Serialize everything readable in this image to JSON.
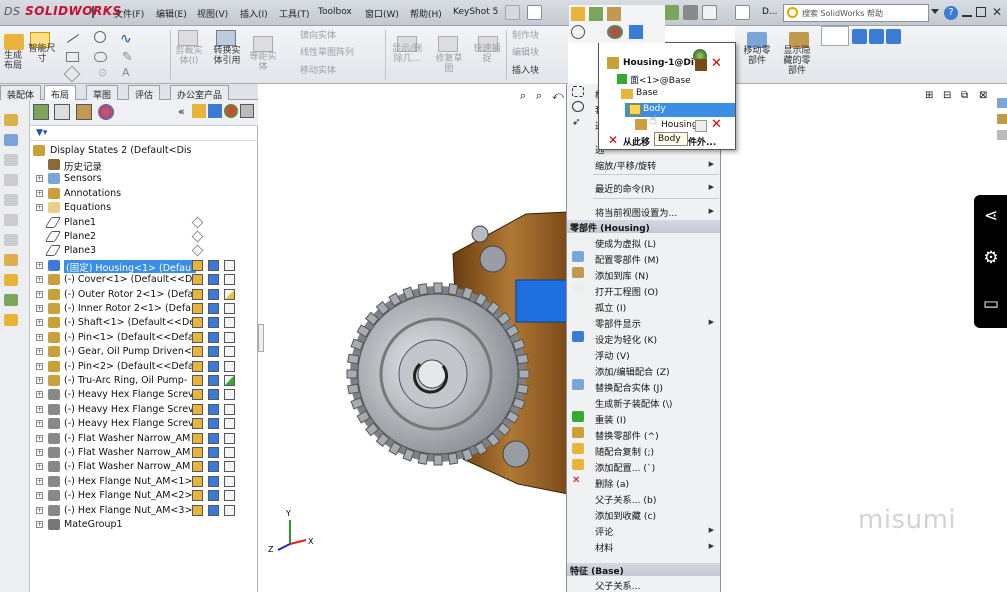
{
  "app": {
    "brand": "SOLIDWORKS",
    "brand_prefix": "DS",
    "title_short": "D..."
  },
  "menubar": [
    {
      "label": "文件(F)"
    },
    {
      "label": "编辑(E)"
    },
    {
      "label": "视图(V)"
    },
    {
      "label": "插入(I)"
    },
    {
      "label": "工具(T)"
    },
    {
      "label": "Toolbox"
    },
    {
      "label": "窗口(W)"
    },
    {
      "label": "帮助(H)"
    },
    {
      "label": "KeyShot 5"
    }
  ],
  "search": {
    "placeholder": "搜索 SolidWorks 帮助"
  },
  "ribbon": {
    "generate_layout": "生成\n布局",
    "smart_dim": "智能尺\n寸",
    "cut_solid": "剪裁实\n体(I)",
    "convert_solid": "转换实\n体引用",
    "offset_solid": "等距实\n体",
    "mirror_solid": "镜向实体",
    "linear_pattern": "线性草图阵列",
    "move_solid": "移动实体",
    "show_hide": "显示/删\n除几...",
    "repair_sketch": "修复草\n图",
    "quick_snap": "快速捕\n捉",
    "make_block": "制作块",
    "edit_block": "编辑块",
    "insert_block": "插入块",
    "move_part": "移动零\n部件",
    "show_hidden": "显示隐\n藏的零\n部件"
  },
  "tabs": [
    {
      "label": "装配体"
    },
    {
      "label": "布局"
    },
    {
      "label": "草图"
    },
    {
      "label": "评估"
    },
    {
      "label": "办公室产品"
    }
  ],
  "tree": {
    "root": "Display States 2  (Default<Dis",
    "nodes": [
      {
        "label": "历史记录",
        "icon": "history-icon"
      },
      {
        "label": "Sensors",
        "icon": "sensor-icon"
      },
      {
        "label": "Annotations",
        "icon": "annotation-icon"
      },
      {
        "label": "Equations",
        "icon": "equation-icon"
      },
      {
        "label": "Plane1",
        "icon": "plane-icon"
      },
      {
        "label": "Plane2",
        "icon": "plane-icon"
      },
      {
        "label": "Plane3",
        "icon": "plane-icon"
      },
      {
        "label": "(固定) Housing<1> (Defaul",
        "icon": "part-icon",
        "selected": true
      },
      {
        "label": "(-) Cover<1> (Default<<De",
        "icon": "part-icon"
      },
      {
        "label": "(-) Outer Rotor 2<1> (Defa",
        "icon": "part-icon"
      },
      {
        "label": "(-) Inner Rotor 2<1> (Defa",
        "icon": "part-icon"
      },
      {
        "label": "(-) Shaft<1> (Default<<De",
        "icon": "part-icon"
      },
      {
        "label": "(-) Pin<1> (Default<<Defa",
        "icon": "part-icon"
      },
      {
        "label": "(-) Gear, Oil Pump Driven<",
        "icon": "part-icon"
      },
      {
        "label": "(-) Pin<2> (Default<<Defa",
        "icon": "part-icon"
      },
      {
        "label": "(-) Tru-Arc Ring, Oil Pump-",
        "icon": "part-icon"
      },
      {
        "label": "(-) Heavy Hex Flange Screv",
        "icon": "toolbox-icon"
      },
      {
        "label": "(-) Heavy Hex Flange Screv",
        "icon": "toolbox-icon"
      },
      {
        "label": "(-) Heavy Hex Flange Screv",
        "icon": "toolbox-icon"
      },
      {
        "label": "(-) Flat Washer Narrow_AM",
        "icon": "toolbox-icon"
      },
      {
        "label": "(-) Flat Washer Narrow_AM",
        "icon": "toolbox-icon"
      },
      {
        "label": "(-) Flat Washer Narrow_AM",
        "icon": "toolbox-icon"
      },
      {
        "label": "(-) Hex Flange Nut_AM<1>",
        "icon": "toolbox-icon"
      },
      {
        "label": "(-) Hex Flange Nut_AM<2>",
        "icon": "toolbox-icon"
      },
      {
        "label": "(-) Hex Flange Nut_AM<3>",
        "icon": "toolbox-icon"
      },
      {
        "label": "MateGroup1",
        "icon": "mate-icon"
      }
    ]
  },
  "popup": {
    "housing": "Housing-1@Di...",
    "face": "面<1>@Base",
    "base": "Base",
    "body": "Body",
    "housing2": "Housing",
    "remove": "从此移",
    "parts_outside": "部件外...",
    "tooltip": "Body"
  },
  "context_menu": {
    "top_items": [
      {
        "label": "框"
      },
      {
        "label": "套"
      },
      {
        "label": "选"
      }
    ],
    "select_other": "选",
    "zoom_pan_rotate": "缩放/平移/旋转",
    "recent_commands": "最近的命令(R)",
    "set_view": "将当前视图设置为...",
    "section_part": "零部件 (Housing)",
    "items": [
      {
        "label": "使成为虚拟 (L)"
      },
      {
        "label": "配置零部件 (M)"
      },
      {
        "label": "添加到库 (N)"
      },
      {
        "label": "打开工程图 (O)"
      },
      {
        "label": "孤立 (I)"
      },
      {
        "label": "零部件显示",
        "submenu": true
      },
      {
        "label": "设定为轻化 (K)"
      },
      {
        "label": "浮动 (V)"
      },
      {
        "label": "添加/编辑配合 (Z)"
      },
      {
        "label": "替换配合实体 (J)"
      },
      {
        "label": "生成新子装配体 (\\)"
      },
      {
        "label": "重装 (I)"
      },
      {
        "label": "替换零部件 (^)"
      },
      {
        "label": "随配合复制 (;)"
      },
      {
        "label": "添加配置... (`)"
      },
      {
        "label": "删除 (a)"
      },
      {
        "label": "父子关系... (b)"
      },
      {
        "label": "添加到收藏 (c)"
      },
      {
        "label": "评论",
        "submenu": true
      },
      {
        "label": "材料",
        "submenu": true
      }
    ],
    "section_feature": "特征 (Base)",
    "feature_item": "父子关系..."
  },
  "watermark": "misumi",
  "colors": {
    "accent": "#3a8ee6",
    "housing": "#8a5a22",
    "gear": "#b8bcc2",
    "social_bar": "#000000"
  }
}
